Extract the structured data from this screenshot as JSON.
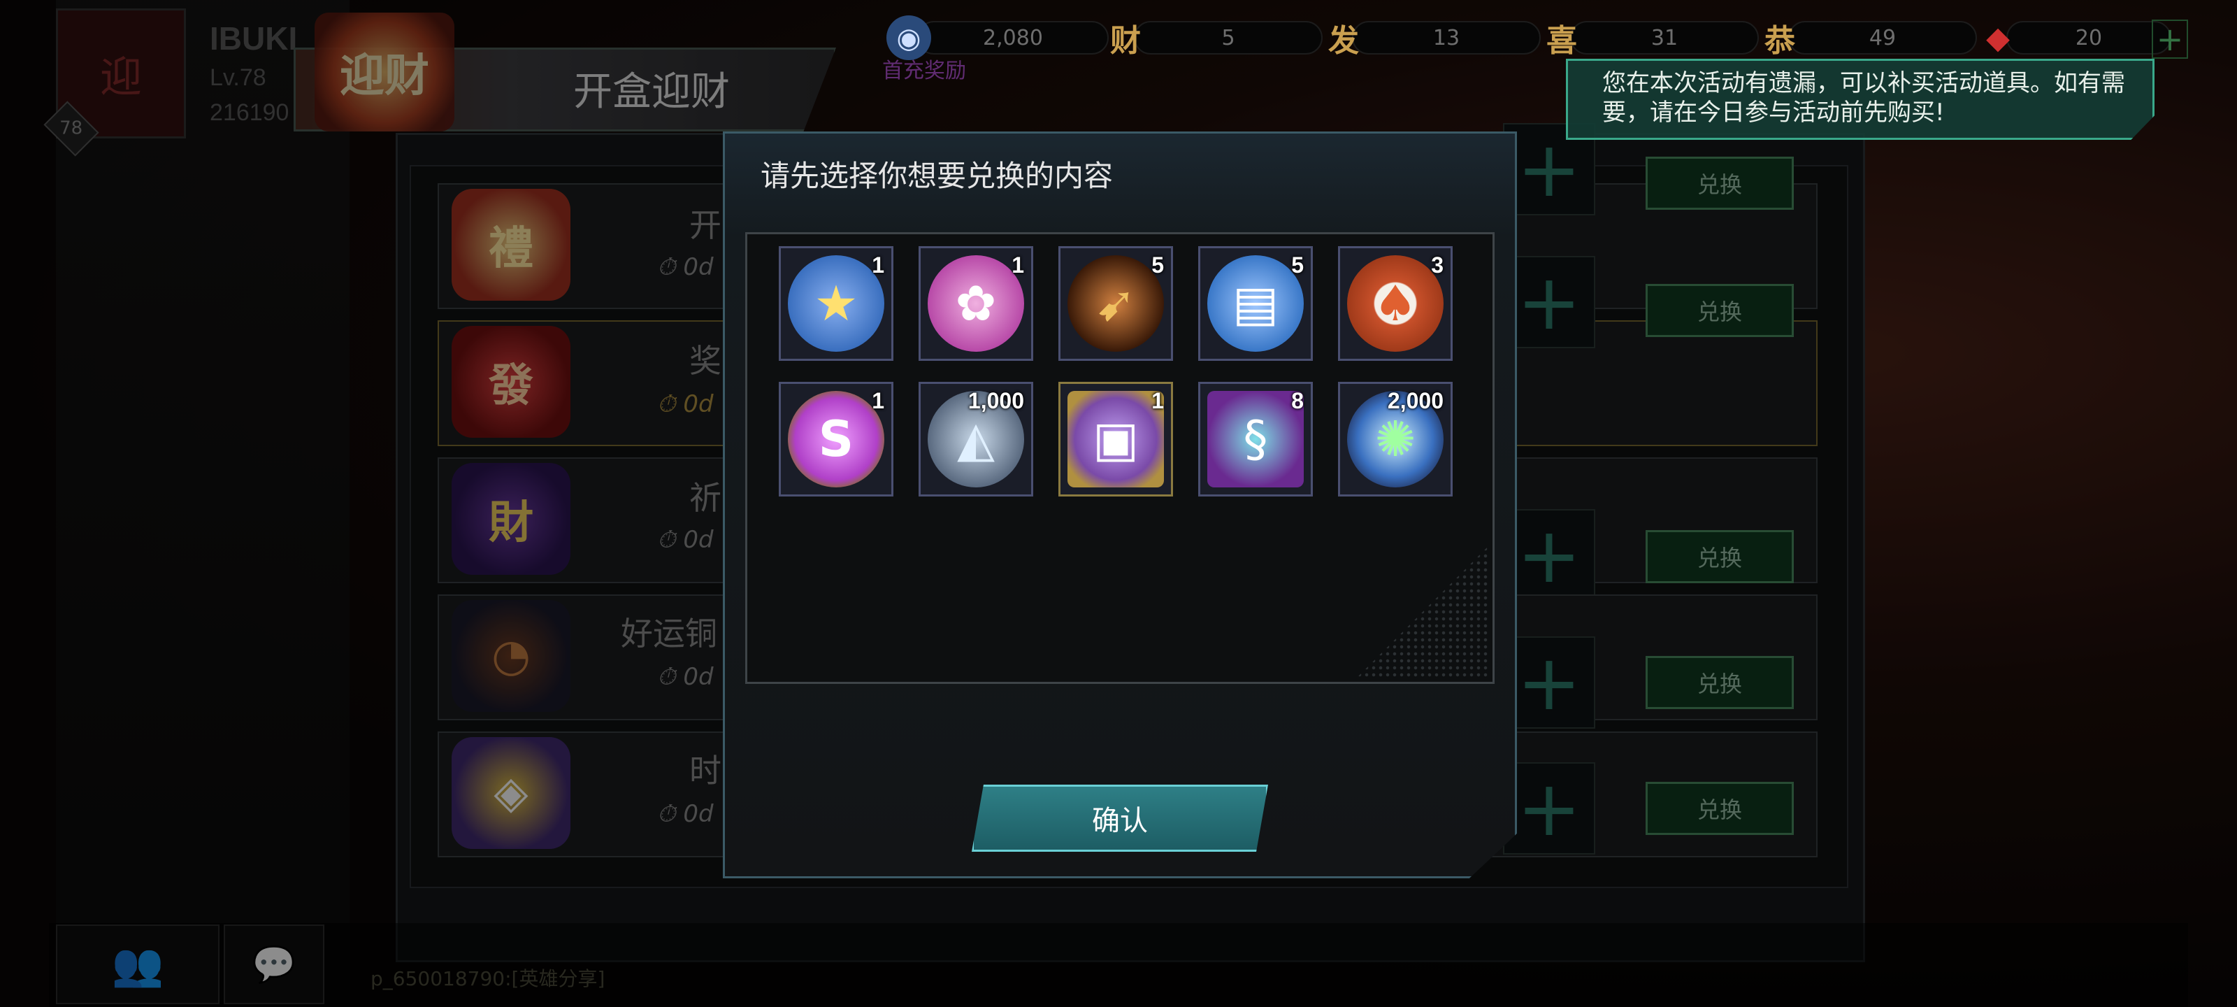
{
  "player": {
    "name": "IBUKI",
    "level": "Lv.78",
    "id": "216190",
    "level_badge": "78"
  },
  "currencies": [
    {
      "icon": "gem-coin-icon",
      "glyph": "◉",
      "value": "2,080"
    },
    {
      "icon": "cai-token-icon",
      "glyph": "财",
      "value": "5"
    },
    {
      "icon": "fa-token-icon",
      "glyph": "发",
      "value": "13"
    },
    {
      "icon": "xi-token-icon",
      "glyph": "喜",
      "value": "31"
    },
    {
      "icon": "gong-token-icon",
      "glyph": "恭",
      "value": "49"
    },
    {
      "icon": "red-envelope-icon",
      "glyph": "◆",
      "value": "20"
    }
  ],
  "currency_add": "+",
  "event": {
    "logo_text": "迎财",
    "title": "开盒迎财",
    "first_reward_label": "首充奖励"
  },
  "tooltip": "您在本次活动有遗漏，可以补买活动道具。如有需要，请在今日参与活动前先购买!",
  "rows": [
    {
      "title": "开",
      "time": "0d",
      "icon_glyph": "禮",
      "button": "兑换"
    },
    {
      "title": "奖",
      "time": "0d",
      "icon_glyph": "發",
      "button": "兑换"
    },
    {
      "title": "祈",
      "time": "0d",
      "icon_glyph": "財",
      "button": "兑换"
    },
    {
      "title": "好运铜",
      "time": "0d",
      "icon_glyph": "◔",
      "button": "兑换"
    },
    {
      "title": "时",
      "time": "0d",
      "icon_glyph": "◈",
      "button": "兑换"
    }
  ],
  "chat_line": "p_650018790:[英雄分享]",
  "modal": {
    "title": "请先选择你想要兑换的内容",
    "items": [
      {
        "name": "police-badge-icon",
        "count": "1",
        "glyph": "★",
        "color": "#3a6fbf"
      },
      {
        "name": "film-reel-icon",
        "count": "1",
        "glyph": "✿",
        "color": "#b84aa8"
      },
      {
        "name": "bullet-icon",
        "count": "5",
        "glyph": "➹",
        "color": "#7a5020"
      },
      {
        "name": "cinema-ticket-icon",
        "count": "5",
        "glyph": "▤",
        "color": "#3a78c8"
      },
      {
        "name": "casino-chip-icon",
        "count": "3",
        "glyph": "♠",
        "color": "#c8502a"
      },
      {
        "name": "bottle-cap-icon",
        "count": "1",
        "glyph": "S",
        "color": "#b040c8"
      },
      {
        "name": "crystal-shard-icon",
        "count": "1,000",
        "glyph": "◭",
        "color": "#5a6a80"
      },
      {
        "name": "treasure-chest-icon",
        "count": "1",
        "glyph": "▣",
        "color": "#7a4aa8"
      },
      {
        "name": "dna-icon",
        "count": "8",
        "glyph": "§",
        "color": "#2a9aa0"
      },
      {
        "name": "energy-orb-icon",
        "count": "2,000",
        "glyph": "✺",
        "color": "#3a70c0"
      }
    ],
    "confirm": "确认"
  }
}
